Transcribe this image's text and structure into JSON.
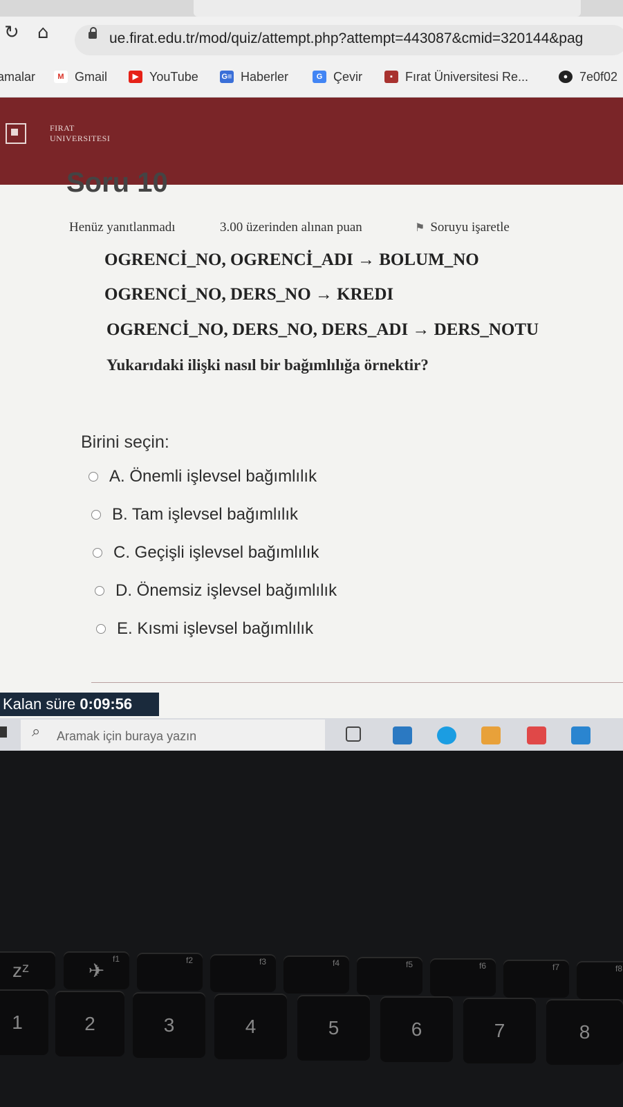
{
  "browser": {
    "url": "ue.firat.edu.tr/mod/quiz/attempt.php?attempt=443087&cmid=320144&pag",
    "bookmarks": [
      {
        "label": "amalar",
        "icon": "none"
      },
      {
        "label": "Gmail",
        "icon": "gmail-icon"
      },
      {
        "label": "YouTube",
        "icon": "youtube-icon"
      },
      {
        "label": "Haberler",
        "icon": "news-icon"
      },
      {
        "label": "Çevir",
        "icon": "translate-icon"
      },
      {
        "label": "Fırat Üniversitesi Re...",
        "icon": "firat-icon"
      },
      {
        "label": "7e0f02",
        "icon": "github-icon"
      }
    ]
  },
  "site": {
    "logo_line1": "FIRAT",
    "logo_line2": "UNIVERSITESI"
  },
  "question": {
    "title": "Soru 10",
    "status": "Henüz yanıtlanmadı",
    "points": "3.00 üzerinden alınan puan",
    "flag_label": "Soruyu işaretle",
    "lines": [
      "OGRENCİ_NO, OGRENCİ_ADI  → BOLUM_NO",
      "OGRENCİ_NO, DERS_NO → KREDI",
      "OGRENCİ_NO, DERS_NO, DERS_ADI → DERS_NOTU"
    ],
    "text": "Yukarıdaki ilişki nasıl bir bağımlılığa örnektir?",
    "prompt": "Birini seçin:",
    "options": [
      "A. Önemli işlevsel bağımlılık",
      "B. Tam işlevsel bağımlılık",
      "C. Geçişli işlevsel bağımlılık",
      "D. Önemsiz işlevsel bağımlılık",
      "E. Kısmi işlevsel bağımlılık"
    ]
  },
  "timer": {
    "label": "Kalan süre",
    "value": "0:09:56"
  },
  "taskbar": {
    "search_placeholder": "Aramak için buraya yazın"
  },
  "keyboard": {
    "fn_keys": [
      "f1",
      "f2",
      "f3",
      "f4",
      "f5",
      "f6",
      "f7",
      "f8"
    ],
    "number_keys": [
      "2",
      "3",
      "4",
      "5",
      "6",
      "7",
      "8"
    ]
  }
}
